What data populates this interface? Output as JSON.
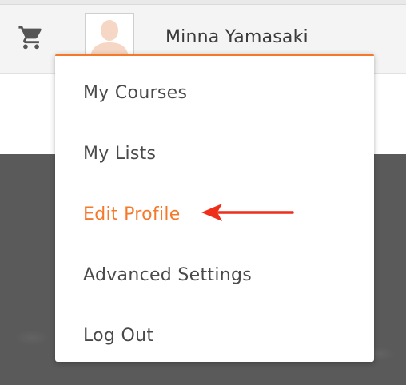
{
  "header": {
    "cart_icon": "shopping-cart-icon",
    "avatar_icon": "user-avatar-icon",
    "username": "Minna Yamasaki"
  },
  "dropdown": {
    "accent_color": "#f4792b",
    "items": [
      {
        "label": "My Courses",
        "active": false
      },
      {
        "label": "My Lists",
        "active": false
      },
      {
        "label": "Edit Profile",
        "active": true
      },
      {
        "label": "Advanced Settings",
        "active": false
      },
      {
        "label": "Log Out",
        "active": false
      }
    ]
  },
  "annotation": {
    "icon": "arrow-left-icon",
    "color": "#ee2f1a"
  }
}
